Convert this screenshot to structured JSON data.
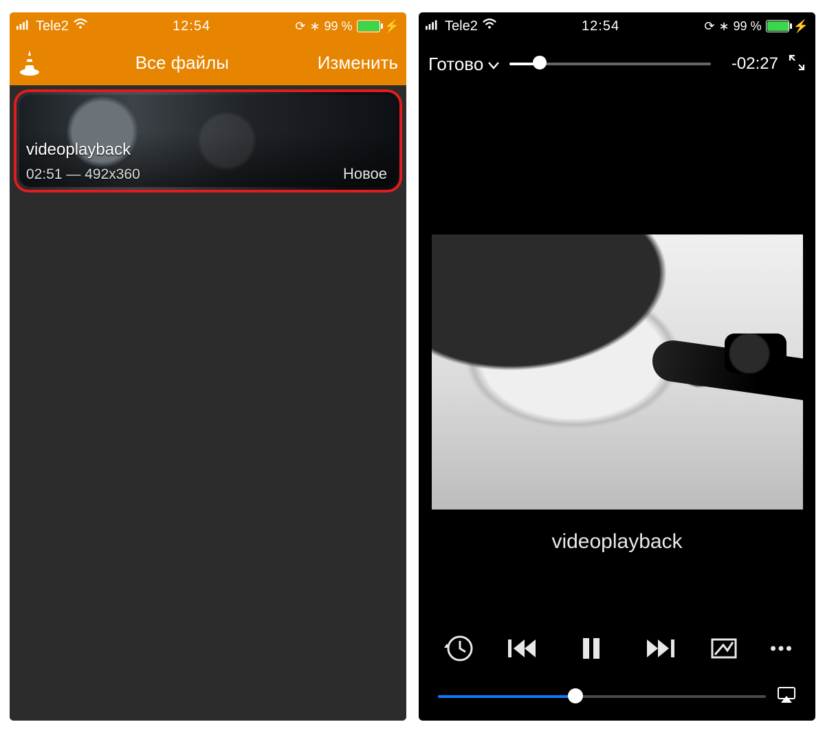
{
  "status": {
    "carrier": "Tele2",
    "time": "12:54",
    "battery_text": "99 %",
    "battery_pct": 99
  },
  "library": {
    "nav_title": "Все файлы",
    "nav_edit": "Изменить",
    "items": [
      {
        "title": "videoplayback",
        "duration": "02:51",
        "resolution": "492x360",
        "meta": "02:51 — 492x360",
        "badge": "Новое"
      }
    ]
  },
  "player": {
    "done_label": "Готово",
    "time_remaining": "-02:27",
    "progress_pct": 15,
    "now_playing": "videoplayback",
    "volume_pct": 42,
    "volume_color": "#0a7bff"
  },
  "colors": {
    "vlc_orange": "#e78400",
    "highlight_red": "#e21c1c",
    "battery_green": "#3cd64b"
  }
}
